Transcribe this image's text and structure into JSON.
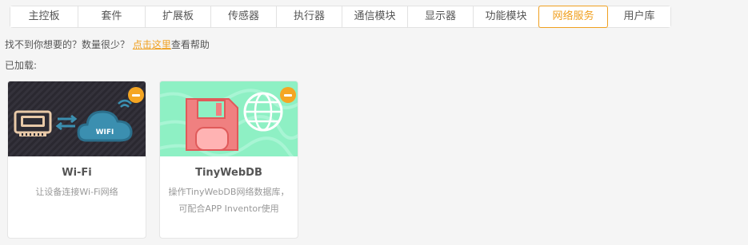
{
  "tabs": [
    {
      "label": "主控板",
      "active": false
    },
    {
      "label": "套件",
      "active": false
    },
    {
      "label": "扩展板",
      "active": false
    },
    {
      "label": "传感器",
      "active": false
    },
    {
      "label": "执行器",
      "active": false
    },
    {
      "label": "通信模块",
      "active": false
    },
    {
      "label": "显示器",
      "active": false
    },
    {
      "label": "功能模块",
      "active": false
    },
    {
      "label": "网络服务",
      "active": true
    },
    {
      "label": "用户库",
      "active": false
    }
  ],
  "hint": {
    "prefix": "找不到你想要的？数量很少？ ",
    "link": "点击这里",
    "suffix": "查看帮助"
  },
  "loaded_label": "已加载:",
  "cards": [
    {
      "title": "Wi-Fi",
      "desc_line1": "让设备连接Wi-Fi网络",
      "desc_line2": "",
      "cloud_text": "WIFI"
    },
    {
      "title": "TinyWebDB",
      "desc_line1": "操作TinyWebDB网络数据库，",
      "desc_line2": "可配合APP Inventor使用"
    }
  ],
  "colors": {
    "accent": "#f0a020",
    "remove_badge": "#f5a623",
    "wifi_banner_bg": "#2d2b33",
    "tinyweb_banner_bg": "#8ef0c4",
    "cloud": "#3b8fb0"
  }
}
